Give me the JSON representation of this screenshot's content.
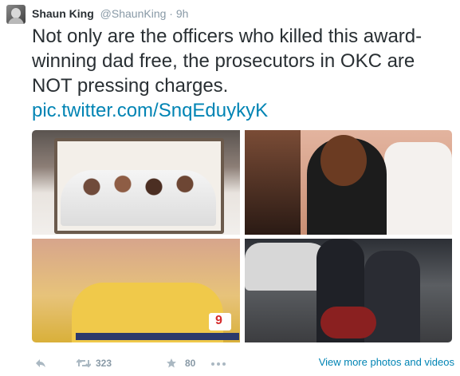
{
  "tweet": {
    "author_name": "Shaun King",
    "handle": "@ShaunKing",
    "separator": "·",
    "time": "9h",
    "text": "Not only are the officers who killed this award-winning dad free, the prosecutors in OKC are NOT pressing charges.",
    "link": "pic.twitter.com/SnqEduykyK"
  },
  "photos": [
    {
      "label": "family-portrait-photo"
    },
    {
      "label": "couple-photo"
    },
    {
      "label": "news-broadcast-photo"
    },
    {
      "label": "arrest-photo"
    }
  ],
  "footer": {
    "retweets": "323",
    "favorites": "80",
    "view_more": "View more photos and videos"
  },
  "colors": {
    "link": "#0084b4",
    "muted": "#8899a6",
    "text": "#292f33"
  }
}
